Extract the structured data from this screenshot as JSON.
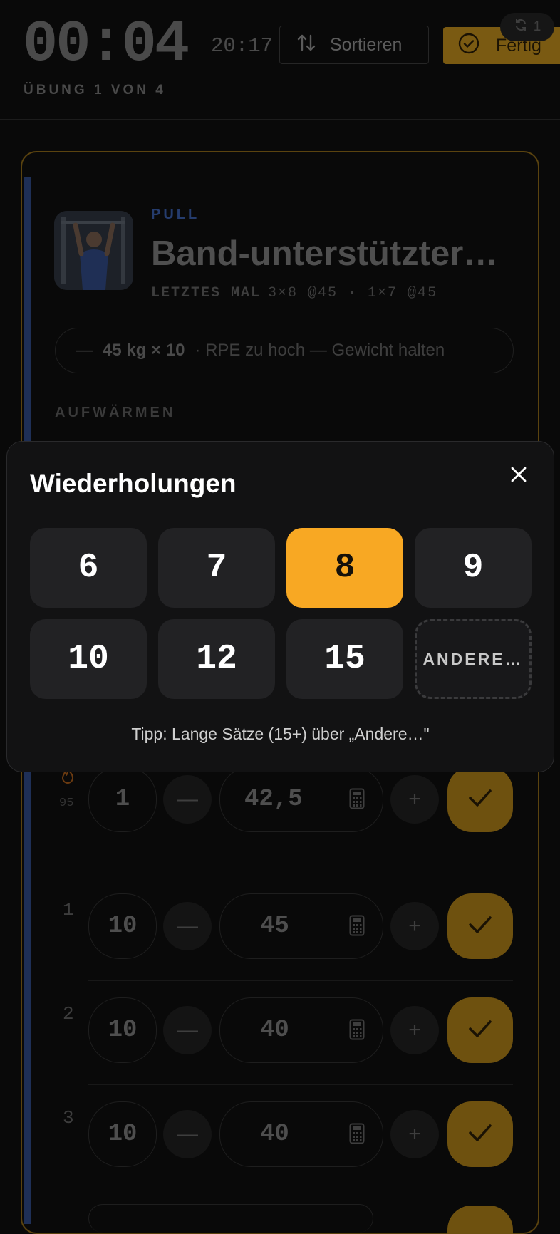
{
  "header": {
    "timer": "00:04",
    "clock": "20:17",
    "sort_label": "Sortieren",
    "done_label": "Fertig",
    "sync_count": "1",
    "exercise_progress": "ÜBUNG 1 VON 4"
  },
  "exercise": {
    "category": "PULL",
    "title": "Band-unterstützter…",
    "last_label": "LETZTES MAL",
    "last_values": "3×8 @45 · 1×7 @45",
    "hint_dash": "—",
    "hint_value": "45 kg × 10",
    "hint_text": "· RPE zu hoch — Gewicht halten",
    "warmup_label": "AUFWÄRMEN"
  },
  "sets": [
    {
      "index": "1",
      "sub": "95",
      "reps": "1",
      "weight": "42,5",
      "warmup": true
    },
    {
      "index": "1",
      "reps": "10",
      "weight": "45"
    },
    {
      "index": "2",
      "reps": "10",
      "weight": "40"
    },
    {
      "index": "3",
      "reps": "10",
      "weight": "40"
    }
  ],
  "sheet": {
    "title": "Wiederholungen",
    "options": [
      "6",
      "7",
      "8",
      "9",
      "10",
      "12",
      "15"
    ],
    "selected": "8",
    "other_label": "ANDERE…",
    "tip": "Tipp: Lange Sätze (15+) über „Andere…\""
  },
  "colors": {
    "accent": "#f8a823",
    "category": "#253c6d",
    "sheet_bg": "#121213",
    "button_bg": "#222224"
  }
}
